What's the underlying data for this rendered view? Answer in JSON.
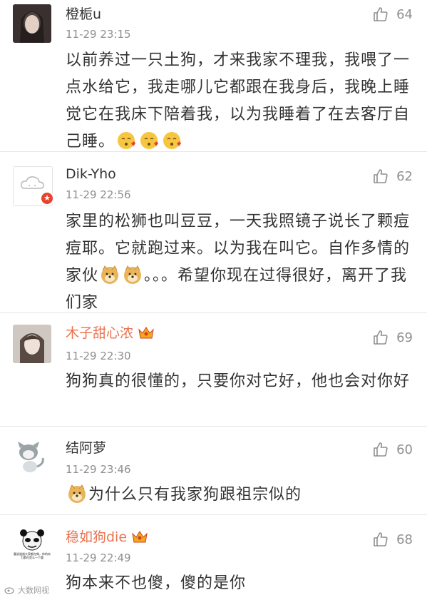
{
  "comments": [
    {
      "username": "橙栀u",
      "time": "11-29 23:15",
      "likes": "64",
      "text": "以前养过一只土狗，才来我家不理我，我喂了一点水给它，我走哪儿它都跟在我身后，我晚上睡觉它在我床下陪着我，以为我睡着了在去客厅自己睡。",
      "emoticons": [
        "kissing-face-icon",
        "kissing-face-icon",
        "kissing-face-icon"
      ]
    },
    {
      "username": "Dik-Yho",
      "time": "11-29 22:56",
      "likes": "62",
      "text_a": "家里的松狮也叫豆豆，一天我照镜子说长了颗痘痘耶。它就跑过来。以为我在叫它。自作多情的家伙",
      "text_b": "。。。希望你现在过得很好，离开了我们家",
      "emoticons": [
        "doge-icon",
        "doge-icon"
      ]
    },
    {
      "username": "木子甜心浓",
      "time": "11-29 22:30",
      "likes": "69",
      "text": "狗狗真的很懂的，只要你对它好，他也会对你好"
    },
    {
      "username": "结阿萝",
      "time": "11-29 23:46",
      "likes": "60",
      "text": "为什么只有我家狗跟祖宗似的",
      "emoticons": [
        "doge-icon"
      ]
    },
    {
      "username": "稳如狗die",
      "time": "11-29 22:49",
      "likes": "68",
      "text": "狗本来不也傻，傻的是你",
      "avatar_caption": "嘉说道道大家都在做，你的实力都在是么一个重"
    }
  ],
  "watermark": "大数网视",
  "colors": {
    "username": "#333333",
    "vip_username": "#eb7350",
    "meta": "#8f8f8f",
    "verified_badge": "#e8412e",
    "divider": "#e6e6e6"
  }
}
